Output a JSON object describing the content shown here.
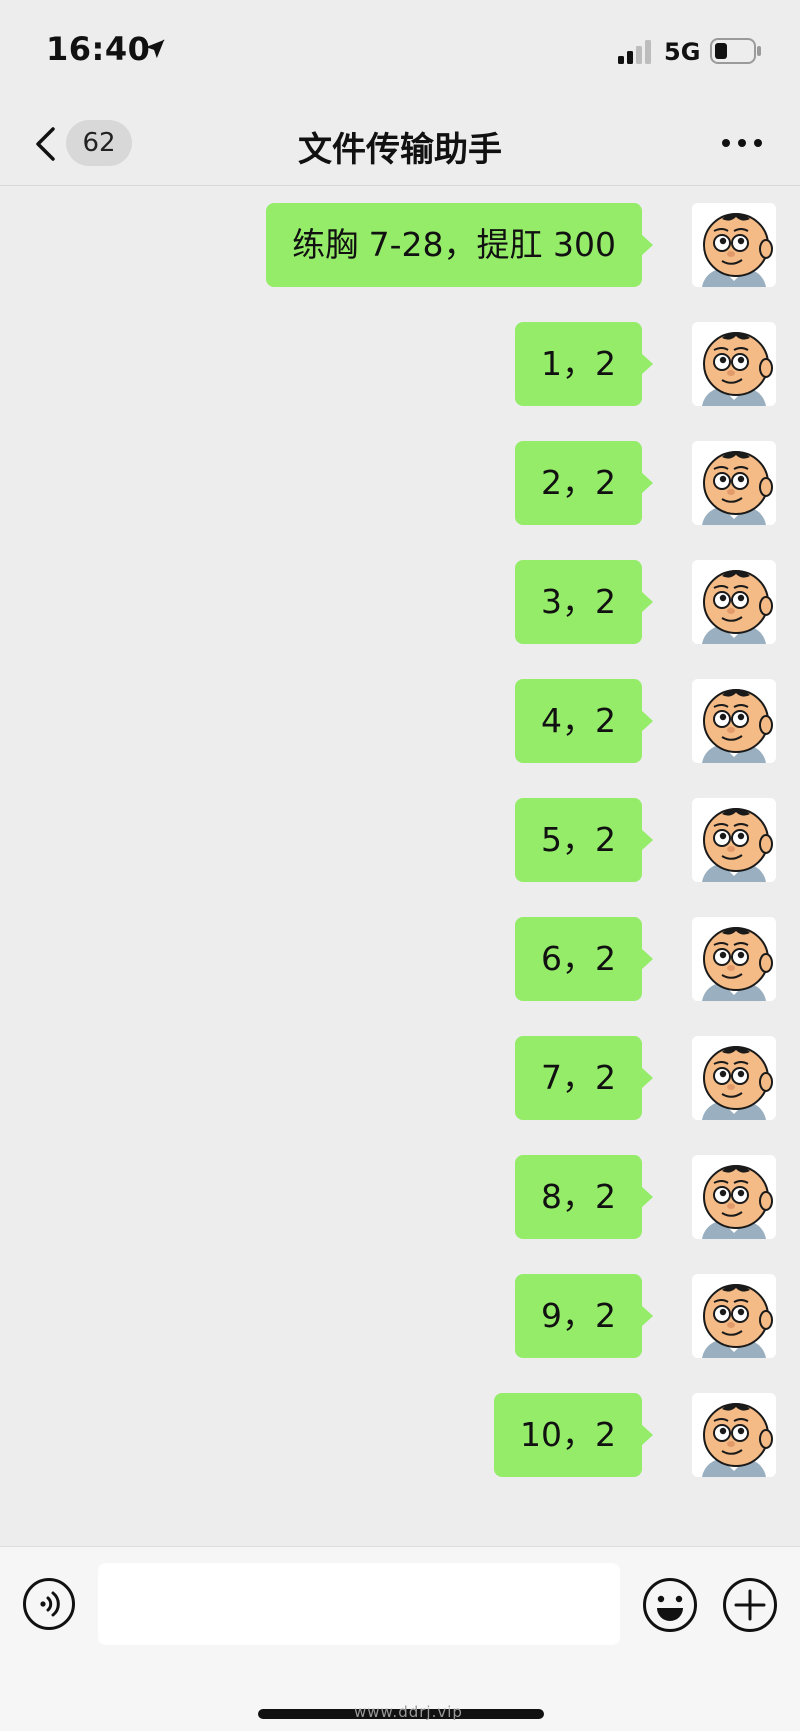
{
  "status_bar": {
    "time": "16:40",
    "network": "5G",
    "icons": [
      "location-arrow-icon",
      "signal-icon",
      "battery-icon"
    ]
  },
  "header": {
    "unread_count": "62",
    "title": "文件传输助手",
    "icons": [
      "chevron-left-icon",
      "more-icon"
    ]
  },
  "messages": [
    {
      "text": "…"
    },
    {
      "text": "练胸 7-28，提肛 300"
    },
    {
      "text": "1，2"
    },
    {
      "text": "2，2"
    },
    {
      "text": "3，2"
    },
    {
      "text": "4，2"
    },
    {
      "text": "5，2"
    },
    {
      "text": "6，2"
    },
    {
      "text": "7，2"
    },
    {
      "text": "8，2"
    },
    {
      "text": "9，2"
    },
    {
      "text": "10，2"
    }
  ],
  "input_bar": {
    "placeholder": "",
    "icons": [
      "voice-icon",
      "emoji-icon",
      "plus-icon"
    ]
  },
  "watermark": "www.ddrj.vip",
  "colors": {
    "background": "#ededed",
    "bubble": "#95ec69",
    "input_bar": "#f6f6f6"
  }
}
